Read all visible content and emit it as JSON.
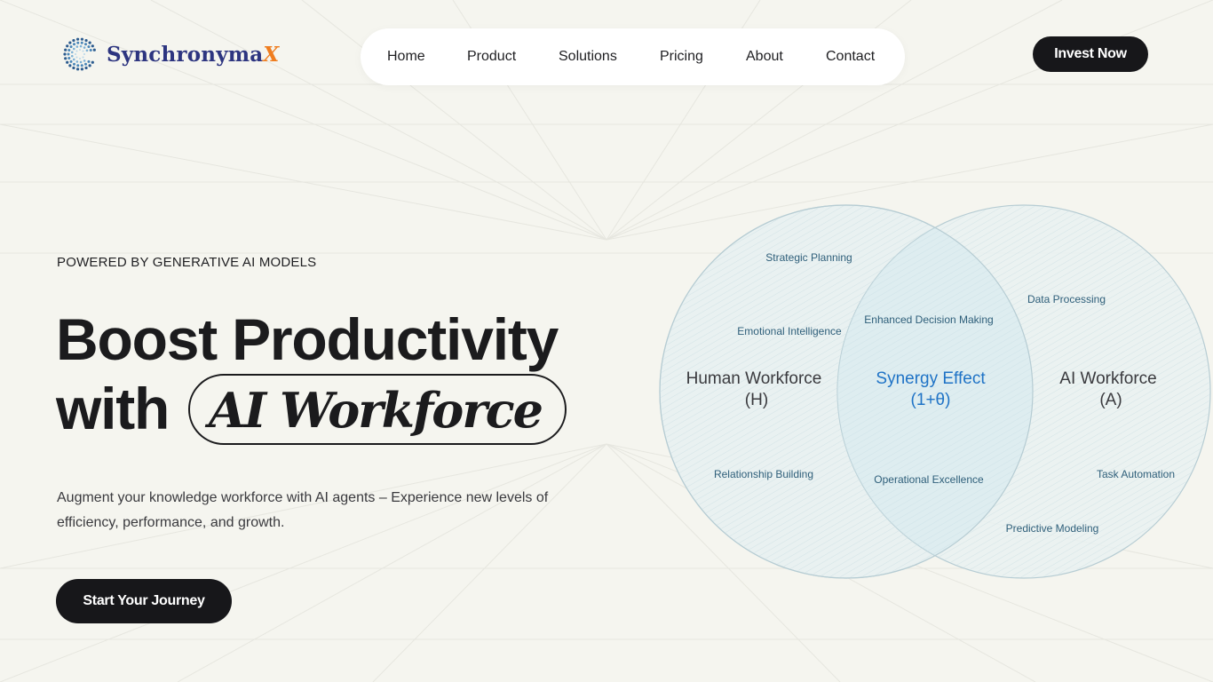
{
  "brand": {
    "name_main": "Synchronyma",
    "name_accent": "X",
    "colors": {
      "primary": "#2d3580",
      "accent": "#ef7d1f"
    }
  },
  "nav": {
    "items": [
      {
        "label": "Home"
      },
      {
        "label": "Product"
      },
      {
        "label": "Solutions"
      },
      {
        "label": "Pricing"
      },
      {
        "label": "About"
      },
      {
        "label": "Contact"
      }
    ]
  },
  "header": {
    "invest_label": "Invest Now"
  },
  "hero": {
    "eyebrow": "POWERED BY GENERATIVE AI MODELS",
    "headline_line1": "Boost Productivity",
    "headline_line2_prefix": "with",
    "headline_highlight": "AI Workforce",
    "subtext": "Augment your knowledge workforce with AI agents – Experience new levels of efficiency, performance, and growth.",
    "cta_label": "Start Your Journey"
  },
  "venn": {
    "left_title": "Human Workforce",
    "left_symbol": "(H)",
    "right_title": "AI Workforce",
    "right_symbol": "(A)",
    "center_title": "Synergy Effect",
    "center_symbol": "(1+θ)",
    "left_items": [
      "Strategic Planning",
      "Emotional Intelligence",
      "Relationship Building"
    ],
    "center_items": [
      "Enhanced Decision Making",
      "Operational Excellence"
    ],
    "right_items": [
      "Data Processing",
      "Task Automation",
      "Predictive Modeling"
    ],
    "colors": {
      "fill": "#dcecf0",
      "stroke": "#b6ccd3",
      "label": "#2f5f7a",
      "synergy": "#1f73c6",
      "title": "#3a3a3e"
    }
  },
  "theme": {
    "background": "#f5f5ef",
    "dark_button": "#17171a",
    "text": "#1b1b1d"
  }
}
